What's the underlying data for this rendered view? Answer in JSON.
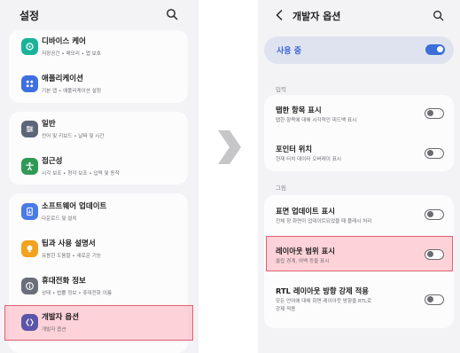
{
  "settings_screen": {
    "title": "설정",
    "items": [
      {
        "title": "디바이스 케어",
        "subtitle": "저장공간 • 메모리 • 앱 보호",
        "icon": "device-care-icon",
        "color": "#19b39a"
      },
      {
        "title": "애플리케이션",
        "subtitle": "기본 앱 • 애플리케이션 설정",
        "icon": "apps-icon",
        "color": "#3f6fe0"
      },
      {
        "title": "일반",
        "subtitle": "언어 및 키보드 • 날짜 및 시간",
        "icon": "general-icon",
        "color": "#5d6678"
      },
      {
        "title": "접근성",
        "subtitle": "시각 보조 • 청각 보조 • 입력 및 동작",
        "icon": "accessibility-icon",
        "color": "#2f9a55"
      },
      {
        "title": "소프트웨어 업데이트",
        "subtitle": "다운로드 및 설치",
        "icon": "software-update-icon",
        "color": "#4a7be6"
      },
      {
        "title": "팁과 사용 설명서",
        "subtitle": "유용한 도움말 • 새로운 기능",
        "icon": "tips-icon",
        "color": "#f1a21e"
      },
      {
        "title": "휴대전화 정보",
        "subtitle": "상태 • 법률 정보 • 휴대전화 이름",
        "icon": "phone-info-icon",
        "color": "#6a6e78"
      },
      {
        "title": "개발자 옵션",
        "subtitle": "개발자 옵션",
        "icon": "developer-options-icon",
        "color": "#5a55a8"
      }
    ]
  },
  "developer_screen": {
    "title": "개발자 옵션",
    "master": {
      "label": "사용 중",
      "on": true
    },
    "sections": {
      "input": "입력",
      "drawing": "그림"
    },
    "options": [
      {
        "title": "탭한 항목 표시",
        "subtitle": [
          "탭한 항목에 대해 시각적인 피드백 표시"
        ],
        "on": false
      },
      {
        "title": "포인터 위치",
        "subtitle": [
          "현재 터치 데이터 오버레이 표시"
        ],
        "on": false
      },
      {
        "title": "표면 업데이트 표시",
        "subtitle": [
          "전체 창 화면이 업데이트되었을 때 플래시 처리"
        ],
        "on": false
      },
      {
        "title": "레이아웃 범위 표시",
        "subtitle": [
          "클립 경계, 여백 등을 표시"
        ],
        "on": false
      },
      {
        "title": "RTL 레이아웃 방향 강제 적용",
        "subtitle": [
          "모든 언어에 대해 화면 레이아웃 방향을 RTL로",
          "강제 적용"
        ],
        "on": false
      }
    ]
  },
  "colors": {
    "accent": "#3b6ed8",
    "highlight": "#e0606f"
  }
}
